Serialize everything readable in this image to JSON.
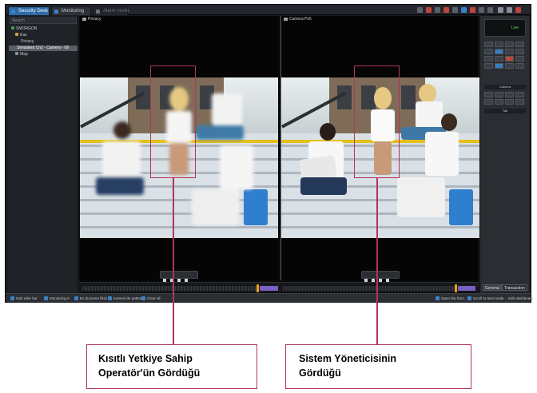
{
  "app": {
    "tabs": [
      {
        "label": "Security Desk",
        "active": true
      },
      {
        "label": "Monitoring",
        "active": false
      },
      {
        "label": "Alarm monit.",
        "active": false
      }
    ],
    "accent_color": "#2e6aa5"
  },
  "left_panel": {
    "search_placeholder": "Search",
    "tree": [
      {
        "label": "SMORGON",
        "level": 0
      },
      {
        "label": "Kas",
        "level": 1
      },
      {
        "label": "Privacy",
        "level": 2
      },
      {
        "label": "Simulated Ch2 - Camera - 09",
        "level": 2,
        "selected": true
      },
      {
        "label": "Map",
        "level": 1
      }
    ]
  },
  "video": {
    "left_pane_title": "Privacy",
    "right_pane_title": "Camera Ps5",
    "left_pane_tag": "Live",
    "right_pane_tag": "Live"
  },
  "right_panel": {
    "live_label": "Live",
    "section_camera": "Camera",
    "section_tab": "Tab",
    "tabs": [
      "General",
      "Transaction"
    ]
  },
  "status_bar": {
    "items": [
      "Kidz eder bar",
      "Monitoring  K",
      "En duzunun fikini",
      "Kamera ile pattern",
      "Clear all"
    ],
    "right_items": [
      "Open the form",
      "Scroll to next mode",
      "Kids dashboard"
    ]
  },
  "annotations": {
    "left_callout_line1": "Kısıtlı Yetkiye Sahip",
    "left_callout_line2": "Operatör'ün Gördüğü",
    "right_callout_line1": "Sistem Yöneticisinin",
    "right_callout_line2": "Gördüğü",
    "color": "#b3345c"
  }
}
